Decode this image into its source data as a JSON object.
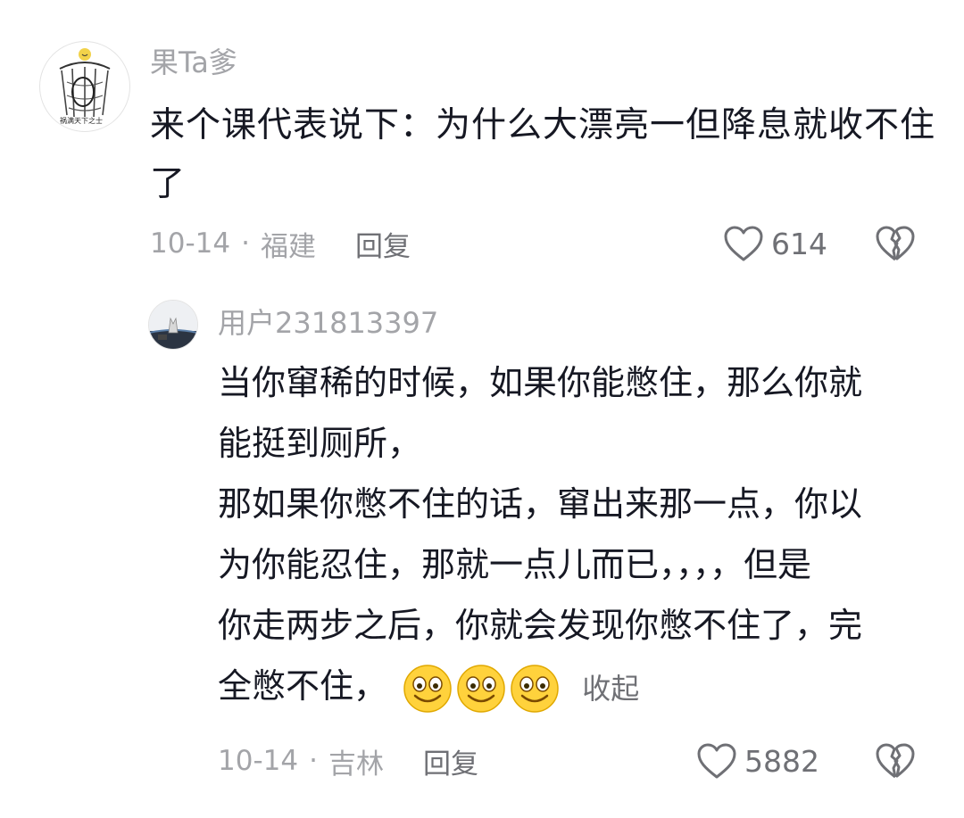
{
  "main_comment": {
    "username": "果Ta爹",
    "avatar_icon": "line-art-avatar",
    "content": "来个课代表说下：为什么大漂亮一但降息就收不住了",
    "date": "10-14",
    "separator": "·",
    "location": "福建",
    "reply_label": "回复",
    "like_count": "614"
  },
  "reply_comment": {
    "username": "用户231813397",
    "avatar_icon": "landscape-avatar",
    "lines": [
      "当你窜稀的时候，如果你能憋住，那么你就",
      "能挺到厕所，",
      "那如果你憋不住的话，窜出来那一点，你以",
      "为你能忍住，那就一点儿而已，，，，但是",
      "你走两步之后，你就会发现你憋不住了，完",
      "全憋不住，"
    ],
    "emojis": [
      "smile-emoji",
      "smile-emoji",
      "smile-emoji"
    ],
    "collapse_label": "收起",
    "date": "10-14",
    "separator": "·",
    "location": "吉林",
    "reply_label": "回复",
    "like_count": "5882"
  },
  "colors": {
    "text_primary": "#161823",
    "text_secondary": "#a3a4a8",
    "text_action": "#6f7075",
    "emoji_fill": "#ffd23c"
  }
}
